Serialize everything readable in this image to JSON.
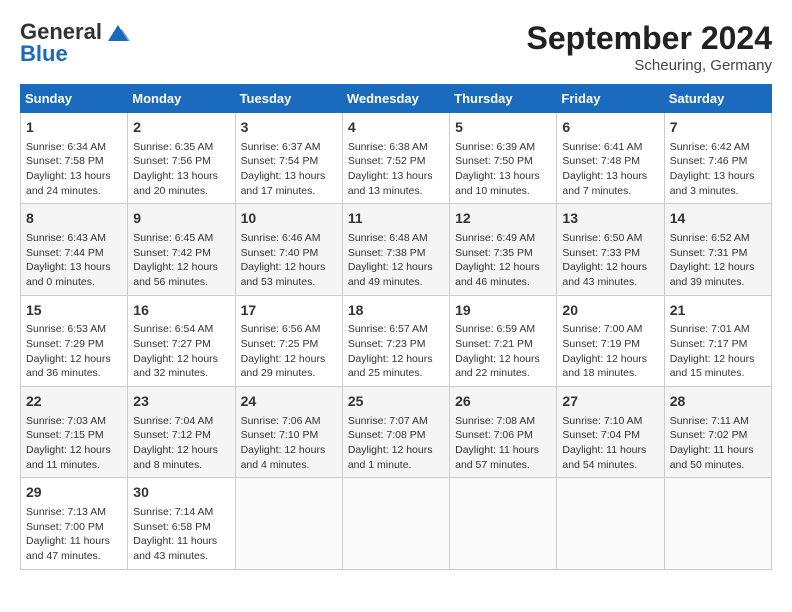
{
  "header": {
    "logo_line1": "General",
    "logo_line2": "Blue",
    "month_title": "September 2024",
    "subtitle": "Scheuring, Germany"
  },
  "days_of_week": [
    "Sunday",
    "Monday",
    "Tuesday",
    "Wednesday",
    "Thursday",
    "Friday",
    "Saturday"
  ],
  "weeks": [
    [
      {
        "day": "1",
        "lines": [
          "Sunrise: 6:34 AM",
          "Sunset: 7:58 PM",
          "Daylight: 13 hours",
          "and 24 minutes."
        ]
      },
      {
        "day": "2",
        "lines": [
          "Sunrise: 6:35 AM",
          "Sunset: 7:56 PM",
          "Daylight: 13 hours",
          "and 20 minutes."
        ]
      },
      {
        "day": "3",
        "lines": [
          "Sunrise: 6:37 AM",
          "Sunset: 7:54 PM",
          "Daylight: 13 hours",
          "and 17 minutes."
        ]
      },
      {
        "day": "4",
        "lines": [
          "Sunrise: 6:38 AM",
          "Sunset: 7:52 PM",
          "Daylight: 13 hours",
          "and 13 minutes."
        ]
      },
      {
        "day": "5",
        "lines": [
          "Sunrise: 6:39 AM",
          "Sunset: 7:50 PM",
          "Daylight: 13 hours",
          "and 10 minutes."
        ]
      },
      {
        "day": "6",
        "lines": [
          "Sunrise: 6:41 AM",
          "Sunset: 7:48 PM",
          "Daylight: 13 hours",
          "and 7 minutes."
        ]
      },
      {
        "day": "7",
        "lines": [
          "Sunrise: 6:42 AM",
          "Sunset: 7:46 PM",
          "Daylight: 13 hours",
          "and 3 minutes."
        ]
      }
    ],
    [
      {
        "day": "8",
        "lines": [
          "Sunrise: 6:43 AM",
          "Sunset: 7:44 PM",
          "Daylight: 13 hours",
          "and 0 minutes."
        ]
      },
      {
        "day": "9",
        "lines": [
          "Sunrise: 6:45 AM",
          "Sunset: 7:42 PM",
          "Daylight: 12 hours",
          "and 56 minutes."
        ]
      },
      {
        "day": "10",
        "lines": [
          "Sunrise: 6:46 AM",
          "Sunset: 7:40 PM",
          "Daylight: 12 hours",
          "and 53 minutes."
        ]
      },
      {
        "day": "11",
        "lines": [
          "Sunrise: 6:48 AM",
          "Sunset: 7:38 PM",
          "Daylight: 12 hours",
          "and 49 minutes."
        ]
      },
      {
        "day": "12",
        "lines": [
          "Sunrise: 6:49 AM",
          "Sunset: 7:35 PM",
          "Daylight: 12 hours",
          "and 46 minutes."
        ]
      },
      {
        "day": "13",
        "lines": [
          "Sunrise: 6:50 AM",
          "Sunset: 7:33 PM",
          "Daylight: 12 hours",
          "and 43 minutes."
        ]
      },
      {
        "day": "14",
        "lines": [
          "Sunrise: 6:52 AM",
          "Sunset: 7:31 PM",
          "Daylight: 12 hours",
          "and 39 minutes."
        ]
      }
    ],
    [
      {
        "day": "15",
        "lines": [
          "Sunrise: 6:53 AM",
          "Sunset: 7:29 PM",
          "Daylight: 12 hours",
          "and 36 minutes."
        ]
      },
      {
        "day": "16",
        "lines": [
          "Sunrise: 6:54 AM",
          "Sunset: 7:27 PM",
          "Daylight: 12 hours",
          "and 32 minutes."
        ]
      },
      {
        "day": "17",
        "lines": [
          "Sunrise: 6:56 AM",
          "Sunset: 7:25 PM",
          "Daylight: 12 hours",
          "and 29 minutes."
        ]
      },
      {
        "day": "18",
        "lines": [
          "Sunrise: 6:57 AM",
          "Sunset: 7:23 PM",
          "Daylight: 12 hours",
          "and 25 minutes."
        ]
      },
      {
        "day": "19",
        "lines": [
          "Sunrise: 6:59 AM",
          "Sunset: 7:21 PM",
          "Daylight: 12 hours",
          "and 22 minutes."
        ]
      },
      {
        "day": "20",
        "lines": [
          "Sunrise: 7:00 AM",
          "Sunset: 7:19 PM",
          "Daylight: 12 hours",
          "and 18 minutes."
        ]
      },
      {
        "day": "21",
        "lines": [
          "Sunrise: 7:01 AM",
          "Sunset: 7:17 PM",
          "Daylight: 12 hours",
          "and 15 minutes."
        ]
      }
    ],
    [
      {
        "day": "22",
        "lines": [
          "Sunrise: 7:03 AM",
          "Sunset: 7:15 PM",
          "Daylight: 12 hours",
          "and 11 minutes."
        ]
      },
      {
        "day": "23",
        "lines": [
          "Sunrise: 7:04 AM",
          "Sunset: 7:12 PM",
          "Daylight: 12 hours",
          "and 8 minutes."
        ]
      },
      {
        "day": "24",
        "lines": [
          "Sunrise: 7:06 AM",
          "Sunset: 7:10 PM",
          "Daylight: 12 hours",
          "and 4 minutes."
        ]
      },
      {
        "day": "25",
        "lines": [
          "Sunrise: 7:07 AM",
          "Sunset: 7:08 PM",
          "Daylight: 12 hours",
          "and 1 minute."
        ]
      },
      {
        "day": "26",
        "lines": [
          "Sunrise: 7:08 AM",
          "Sunset: 7:06 PM",
          "Daylight: 11 hours",
          "and 57 minutes."
        ]
      },
      {
        "day": "27",
        "lines": [
          "Sunrise: 7:10 AM",
          "Sunset: 7:04 PM",
          "Daylight: 11 hours",
          "and 54 minutes."
        ]
      },
      {
        "day": "28",
        "lines": [
          "Sunrise: 7:11 AM",
          "Sunset: 7:02 PM",
          "Daylight: 11 hours",
          "and 50 minutes."
        ]
      }
    ],
    [
      {
        "day": "29",
        "lines": [
          "Sunrise: 7:13 AM",
          "Sunset: 7:00 PM",
          "Daylight: 11 hours",
          "and 47 minutes."
        ]
      },
      {
        "day": "30",
        "lines": [
          "Sunrise: 7:14 AM",
          "Sunset: 6:58 PM",
          "Daylight: 11 hours",
          "and 43 minutes."
        ]
      },
      {
        "day": "",
        "lines": []
      },
      {
        "day": "",
        "lines": []
      },
      {
        "day": "",
        "lines": []
      },
      {
        "day": "",
        "lines": []
      },
      {
        "day": "",
        "lines": []
      }
    ]
  ]
}
